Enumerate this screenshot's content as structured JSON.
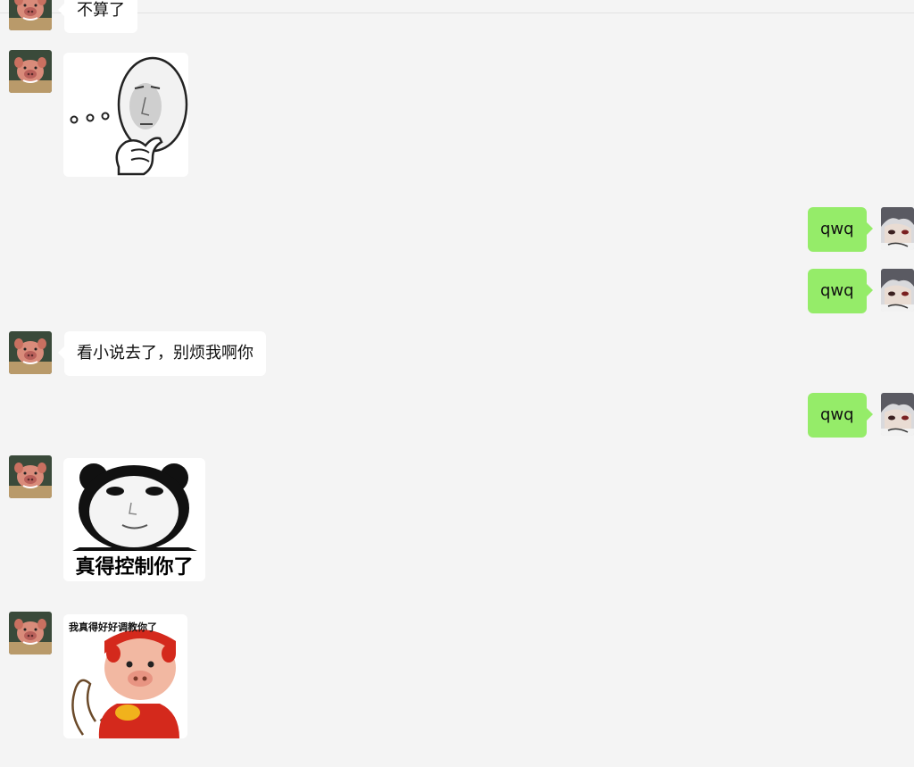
{
  "messages": {
    "m1_text": "不算了",
    "m4_text": "qwq",
    "m5_text": "qwq",
    "m6_text": "看小说去了，别烦我啊你",
    "m7_text": "qwq",
    "m8_caption": "真得控制你了",
    "m9_caption": "我真得好好调教你了"
  },
  "colors": {
    "chat_background": "#f4f4f4",
    "incoming_bubble": "#ffffff",
    "outgoing_bubble": "#95ec69"
  },
  "icons": {
    "contact_avatar": "pig-avatar-icon",
    "self_avatar": "anime-avatar-icon"
  }
}
